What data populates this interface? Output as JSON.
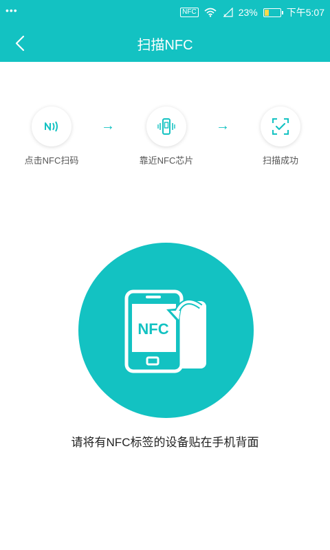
{
  "status_bar": {
    "dots": "•••",
    "nfc": "NFC",
    "battery": "23%",
    "time": "下午5:07"
  },
  "header": {
    "title": "扫描NFC"
  },
  "steps": [
    {
      "label": "点击NFC扫码",
      "icon": "nfc-signal-icon"
    },
    {
      "label": "靠近NFC芯片",
      "icon": "phone-vibrate-icon"
    },
    {
      "label": "扫描成功",
      "icon": "scan-check-icon"
    }
  ],
  "step_arrow": "→",
  "main_illustration": {
    "text": "NFC",
    "icon": "phone-nfc-tap-icon"
  },
  "instruction": "请将有NFC标签的设备贴在手机背面",
  "colors": {
    "accent": "#13c2c2",
    "text_dark": "#222222",
    "text_gray": "#555555"
  }
}
